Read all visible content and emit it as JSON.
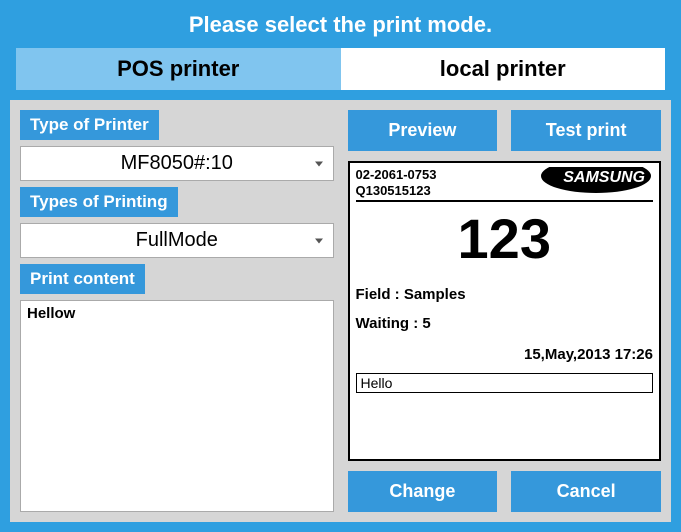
{
  "title": "Please select the print mode.",
  "tabs": {
    "pos": "POS printer",
    "local": "local printer"
  },
  "left": {
    "type_of_printer_label": "Type of Printer",
    "printer_selected": "MF8050#:10",
    "types_of_printing_label": "Types of Printing",
    "printing_mode_selected": "FullMode",
    "print_content_label": "Print content",
    "print_content_value": "Hellow"
  },
  "right": {
    "preview_btn": "Preview",
    "test_print_btn": "Test print",
    "change_btn": "Change",
    "cancel_btn": "Cancel"
  },
  "preview": {
    "id1": "02-2061-0753",
    "id2": "Q130515123",
    "logo": "SAMSUNG",
    "ticket_number": "123",
    "field_line": "Field : Samples",
    "waiting_line": "Waiting : 5",
    "datetime": "15,May,2013   17:26",
    "input_value": "Hello"
  }
}
